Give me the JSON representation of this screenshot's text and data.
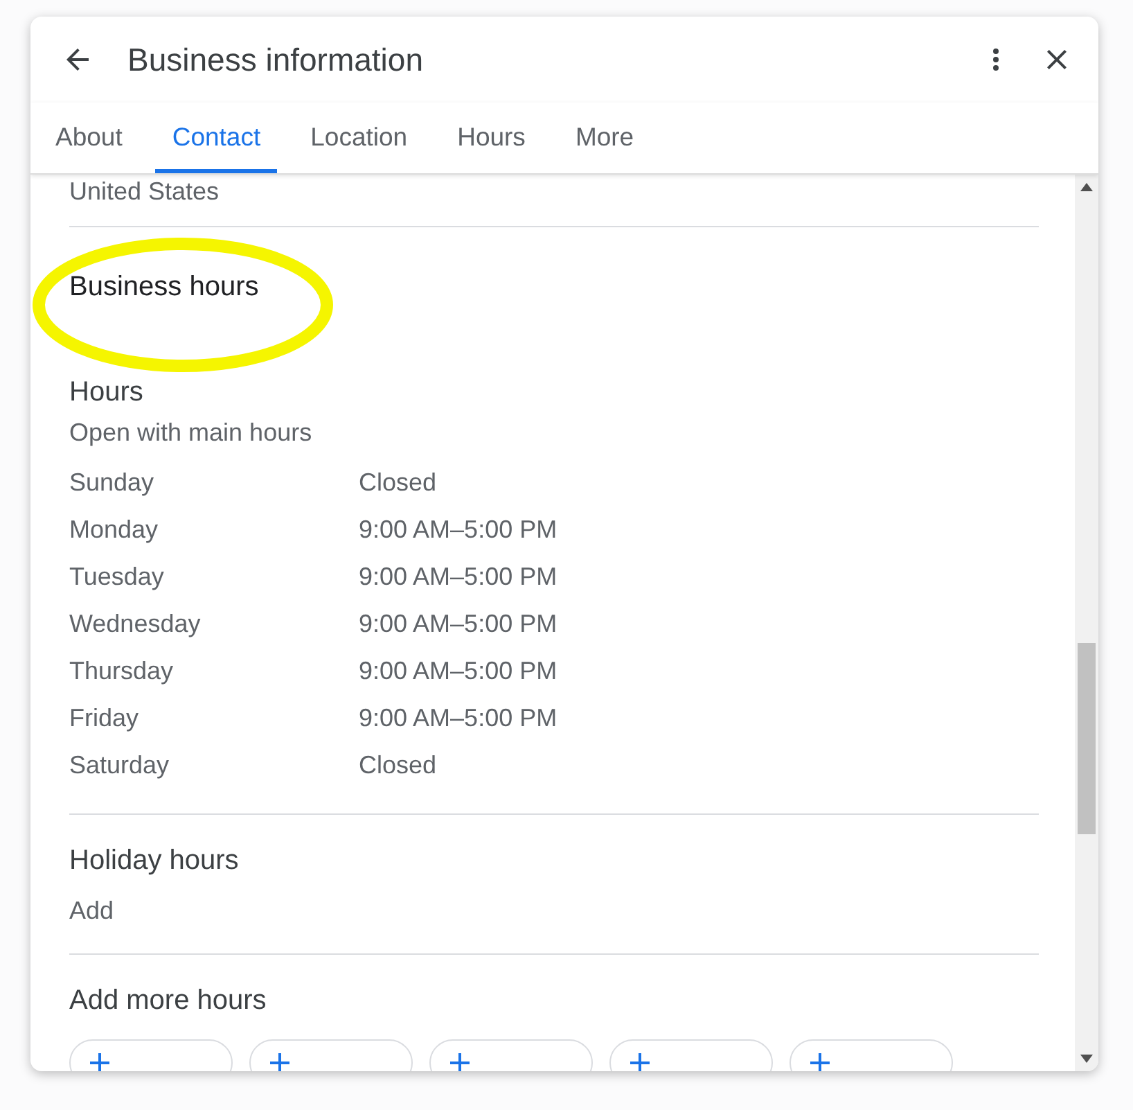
{
  "dialog": {
    "title": "Business information"
  },
  "tabs": [
    {
      "label": "About",
      "selected": false
    },
    {
      "label": "Contact",
      "selected": true
    },
    {
      "label": "Location",
      "selected": false
    },
    {
      "label": "Hours",
      "selected": false
    },
    {
      "label": "More",
      "selected": false
    }
  ],
  "address_tail": "United States",
  "section_title": "Business hours",
  "hours": {
    "title": "Hours",
    "subtitle": "Open with main hours",
    "days": [
      {
        "day": "Sunday",
        "time": "Closed"
      },
      {
        "day": "Monday",
        "time": "9:00 AM–5:00 PM"
      },
      {
        "day": "Tuesday",
        "time": "9:00 AM–5:00 PM"
      },
      {
        "day": "Wednesday",
        "time": "9:00 AM–5:00 PM"
      },
      {
        "day": "Thursday",
        "time": "9:00 AM–5:00 PM"
      },
      {
        "day": "Friday",
        "time": "9:00 AM–5:00 PM"
      },
      {
        "day": "Saturday",
        "time": "Closed"
      }
    ]
  },
  "holiday_hours": {
    "title": "Holiday hours",
    "action": "Add"
  },
  "more_hours": {
    "title": "Add more hours",
    "chips": [
      {
        "kind": "add"
      },
      {
        "kind": "add"
      },
      {
        "kind": "add"
      },
      {
        "kind": "add"
      },
      {
        "kind": "add"
      }
    ]
  }
}
